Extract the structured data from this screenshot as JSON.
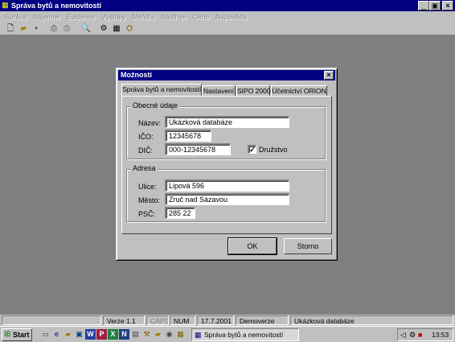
{
  "app": {
    "title": "Správa bytů a nemovitostí",
    "caption_buttons": {
      "minimize": "_",
      "restore": "▣",
      "close": "×"
    }
  },
  "menu": [
    "Správa",
    "Nájemné",
    "Evidence",
    "Výstupy",
    "Měřidla",
    "Nástroje",
    "Okno",
    "Nápověda"
  ],
  "dialog": {
    "title": "Možnosti",
    "close": "×",
    "tabs": [
      "Správa bytů a nemovitostí",
      "Nastavení",
      "SIPO 2000",
      "Účetnictví ORION"
    ],
    "general": {
      "group_label": "Obecné údaje",
      "name_label": "Název:",
      "name_value": "Ukázková databáze",
      "ico_label": "IČO:",
      "ico_value": "12345678",
      "dic_label": "DIČ:",
      "dic_value": "000-12345678",
      "cooperative_label": "Družstvo",
      "cooperative_checked": "✓"
    },
    "address": {
      "group_label": "Adresa",
      "street_label": "Ulice:",
      "street_value": "Lipová 596",
      "city_label": "Město:",
      "city_value": "Zruč nad Sázavou",
      "zip_label": "PSČ:",
      "zip_value": "285 22"
    },
    "ok": "OK",
    "cancel": "Storno"
  },
  "statusbar": {
    "version": "Verze 1.1",
    "caps": "CAPS",
    "num": "NUM",
    "date": "17.7.2001",
    "mode": "Demoverze",
    "database": "Ukázková databáze"
  },
  "taskbar": {
    "start": "Start",
    "task": "Správa bytů a nemovitostí",
    "clock": "13:53"
  },
  "colors": {
    "titlebar": "#000080",
    "face": "#c0c0c0",
    "desktop": "#808080"
  }
}
